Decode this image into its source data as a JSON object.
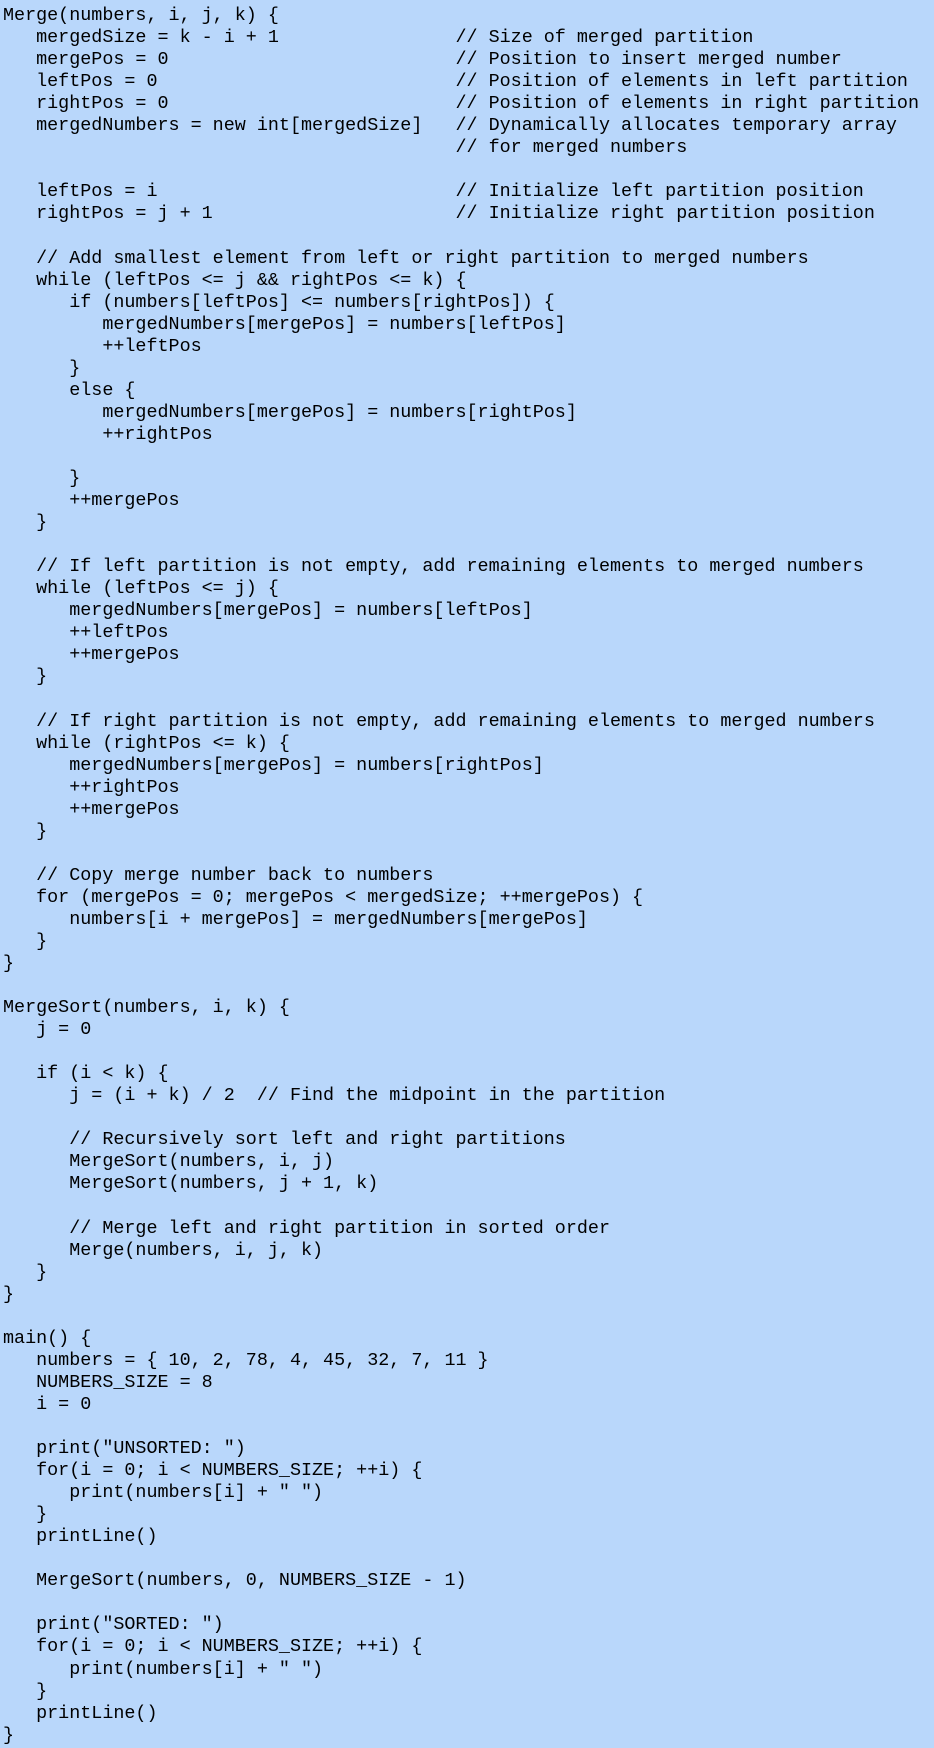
{
  "code": {
    "lines": [
      "Merge(numbers, i, j, k) {",
      "   mergedSize = k - i + 1                // Size of merged partition",
      "   mergePos = 0                          // Position to insert merged number",
      "   leftPos = 0                           // Position of elements in left partition",
      "   rightPos = 0                          // Position of elements in right partition",
      "   mergedNumbers = new int[mergedSize]   // Dynamically allocates temporary array",
      "                                         // for merged numbers",
      "",
      "   leftPos = i                           // Initialize left partition position",
      "   rightPos = j + 1                      // Initialize right partition position",
      "",
      "   // Add smallest element from left or right partition to merged numbers",
      "   while (leftPos <= j && rightPos <= k) {",
      "      if (numbers[leftPos] <= numbers[rightPos]) {",
      "         mergedNumbers[mergePos] = numbers[leftPos]",
      "         ++leftPos",
      "      }",
      "      else {",
      "         mergedNumbers[mergePos] = numbers[rightPos]",
      "         ++rightPos",
      "",
      "      }",
      "      ++mergePos",
      "   }",
      "",
      "   // If left partition is not empty, add remaining elements to merged numbers",
      "   while (leftPos <= j) {",
      "      mergedNumbers[mergePos] = numbers[leftPos]",
      "      ++leftPos",
      "      ++mergePos",
      "   }",
      "",
      "   // If right partition is not empty, add remaining elements to merged numbers",
      "   while (rightPos <= k) {",
      "      mergedNumbers[mergePos] = numbers[rightPos]",
      "      ++rightPos",
      "      ++mergePos",
      "   }",
      "",
      "   // Copy merge number back to numbers",
      "   for (mergePos = 0; mergePos < mergedSize; ++mergePos) {",
      "      numbers[i + mergePos] = mergedNumbers[mergePos]",
      "   }",
      "}",
      "",
      "MergeSort(numbers, i, k) {",
      "   j = 0",
      "",
      "   if (i < k) {",
      "      j = (i + k) / 2  // Find the midpoint in the partition",
      "",
      "      // Recursively sort left and right partitions",
      "      MergeSort(numbers, i, j)",
      "      MergeSort(numbers, j + 1, k)",
      "",
      "      // Merge left and right partition in sorted order",
      "      Merge(numbers, i, j, k)",
      "   }",
      "}",
      "",
      "main() {",
      "   numbers = { 10, 2, 78, 4, 45, 32, 7, 11 }",
      "   NUMBERS_SIZE = 8",
      "   i = 0",
      "",
      "   print(\"UNSORTED: \")",
      "   for(i = 0; i < NUMBERS_SIZE; ++i) {",
      "      print(numbers[i] + \" \")",
      "   }",
      "   printLine()",
      "",
      "   MergeSort(numbers, 0, NUMBERS_SIZE - 1)",
      "",
      "   print(\"SORTED: \")",
      "   for(i = 0; i < NUMBERS_SIZE; ++i) {",
      "      print(numbers[i] + \" \")",
      "   }",
      "   printLine()",
      "}"
    ]
  }
}
